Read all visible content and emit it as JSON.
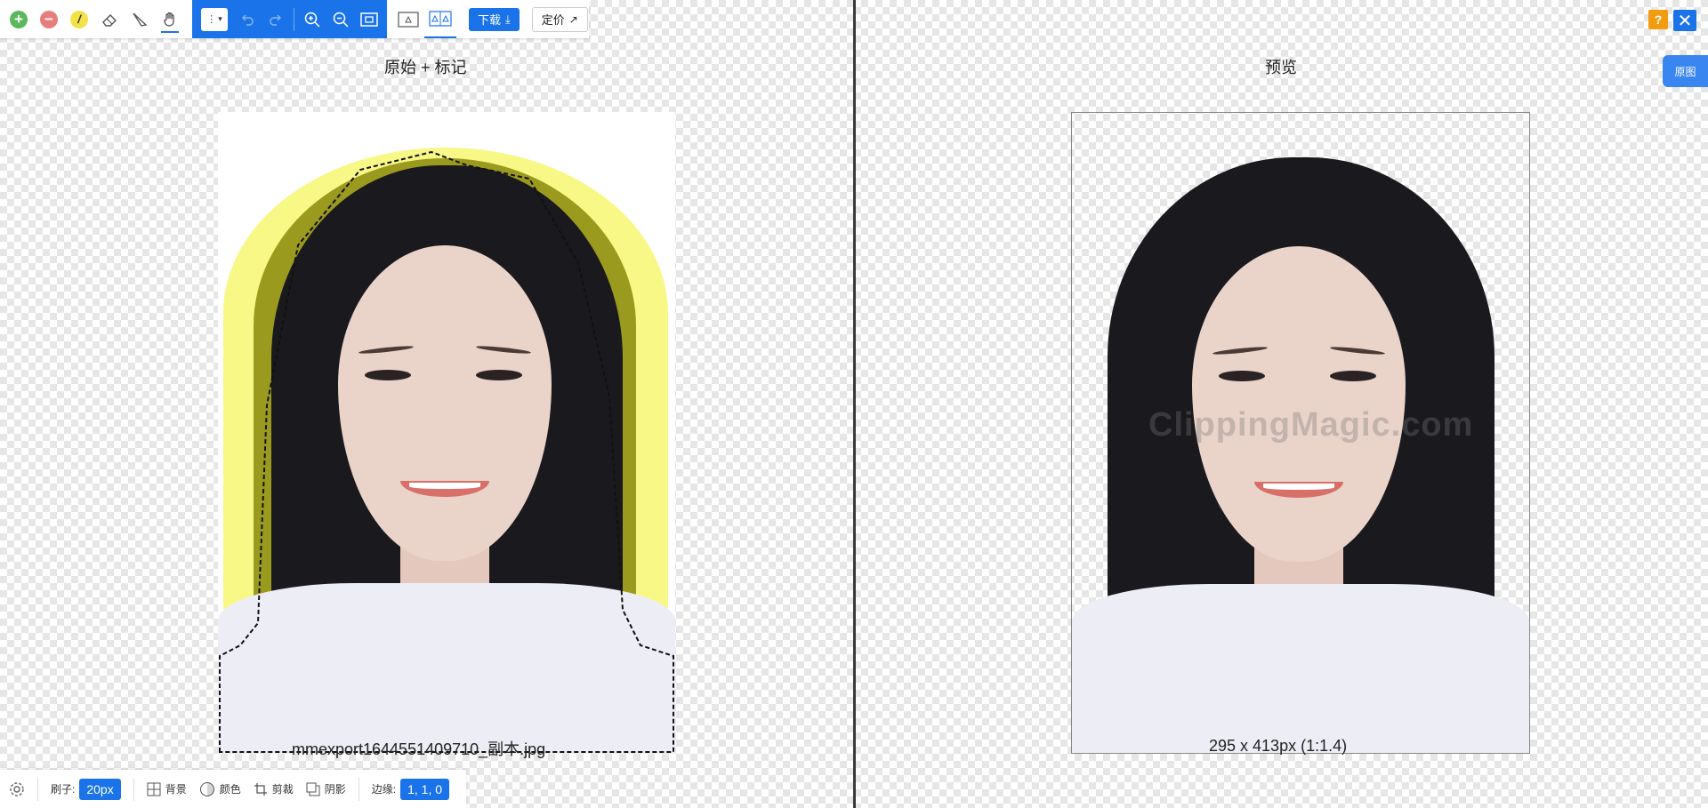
{
  "toolbar": {
    "tools": [
      {
        "name": "add-marker",
        "icon": "plus-circle-icon",
        "color": "#4caf50"
      },
      {
        "name": "remove-marker",
        "icon": "minus-circle-icon",
        "color": "#e57373"
      },
      {
        "name": "hair-marker",
        "icon": "hair-brush-icon",
        "color": "#f4e04d"
      },
      {
        "name": "eraser",
        "icon": "eraser-icon"
      },
      {
        "name": "scalpel",
        "icon": "scalpel-icon"
      },
      {
        "name": "pan",
        "icon": "hand-icon"
      }
    ],
    "select_label": "⋮",
    "view_modes": [
      "single-view",
      "dual-view"
    ],
    "download_label": "下载",
    "pricing_label": "定价"
  },
  "left_panel": {
    "title": "原始 + 标记",
    "filename": "mmexport1644551409710_副本.jpg"
  },
  "right_panel": {
    "title": "预览",
    "dimensions": "295 x 413px (1:1.4)",
    "watermark": "ClippingMagic.com"
  },
  "bottom": {
    "brush_label": "刷子:",
    "brush_value": "20px",
    "background_label": "背景",
    "color_label": "颜色",
    "crop_label": "剪裁",
    "shadow_label": "阴影",
    "edges_label": "边缘:",
    "edges_value": "1, 1, 0"
  },
  "top_right": {
    "help_label": "?",
    "close_label": "✕",
    "original_tab_label": "原图"
  },
  "colors": {
    "accent": "#1a73e8",
    "help": "#f39c12",
    "hair_marker": "#f4f480"
  }
}
